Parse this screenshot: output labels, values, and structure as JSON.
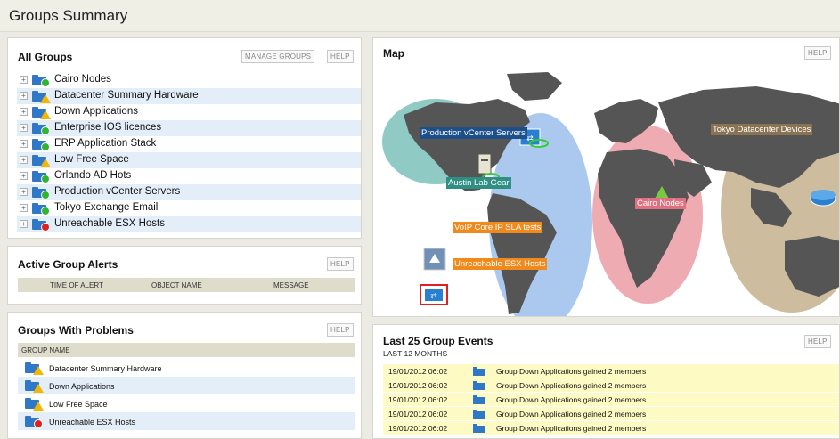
{
  "page": {
    "title": "Groups Summary"
  },
  "all_groups": {
    "title": "All Groups",
    "manage_label": "MANAGE GROUPS",
    "help_label": "HELP",
    "items": [
      {
        "label": "Cairo Nodes",
        "status": "up"
      },
      {
        "label": "Datacenter Summary Hardware",
        "status": "warning"
      },
      {
        "label": "Down Applications",
        "status": "warning"
      },
      {
        "label": "Enterprise IOS licences",
        "status": "up"
      },
      {
        "label": "ERP Application Stack",
        "status": "up"
      },
      {
        "label": "Low Free Space",
        "status": "warning"
      },
      {
        "label": "Orlando AD Hots",
        "status": "up"
      },
      {
        "label": "Production vCenter Servers",
        "status": "up"
      },
      {
        "label": "Tokyo Exchange Email",
        "status": "up"
      },
      {
        "label": "Unreachable ESX Hosts",
        "status": "down"
      }
    ]
  },
  "alerts": {
    "title": "Active Group Alerts",
    "help_label": "HELP",
    "columns": [
      "TIME OF ALERT",
      "OBJECT NAME",
      "MESSAGE"
    ]
  },
  "problems": {
    "title": "Groups With Problems",
    "help_label": "HELP",
    "column": "GROUP NAME",
    "items": [
      {
        "label": "Datacenter Summary Hardware",
        "status": "warning"
      },
      {
        "label": "Down Applications",
        "status": "warning"
      },
      {
        "label": "Low Free Space",
        "status": "warning"
      },
      {
        "label": "Unreachable ESX Hosts",
        "status": "down"
      }
    ]
  },
  "map": {
    "title": "Map",
    "help_label": "HELP",
    "labels": {
      "production": "Production vCenter Servers",
      "austin": "Austin Lab Gear",
      "voip": "VoIP Core IP SLA tests",
      "unreachable": "Unreachable ESX Hosts",
      "cairo": "Cairo Nodes",
      "tokyo": "Tokyo Datacenter Devices"
    }
  },
  "events": {
    "title": "Last 25 Group Events",
    "subtitle": "LAST 12 MONTHS",
    "help_label": "HELP",
    "items": [
      {
        "time": "19/01/2012 06:02",
        "message": "Group Down Applications gained 2 members"
      },
      {
        "time": "19/01/2012 06:02",
        "message": "Group Down Applications gained 2 members"
      },
      {
        "time": "19/01/2012 06:02",
        "message": "Group Down Applications gained 2 members"
      },
      {
        "time": "19/01/2012 06:02",
        "message": "Group Down Applications gained 2 members"
      },
      {
        "time": "19/01/2012 06:02",
        "message": "Group Down Applications gained 2 members"
      }
    ]
  },
  "colors": {
    "folder": "#2f78c8",
    "status_up": "#2fb52f",
    "status_warning": "#f2b705",
    "status_down": "#e02020",
    "row_alt": "#e4eef8",
    "event_row": "#fdfac4"
  }
}
